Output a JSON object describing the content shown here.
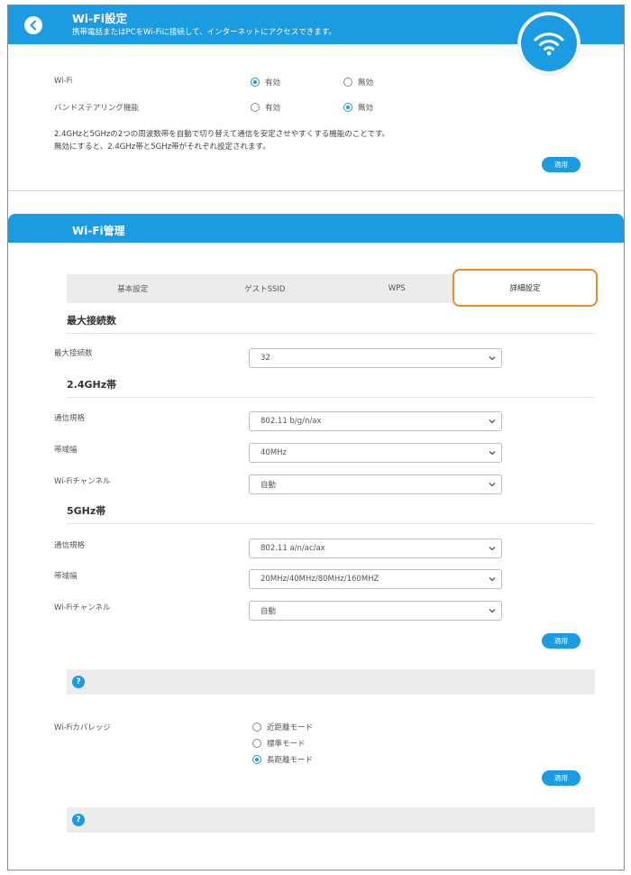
{
  "wifi_settings": {
    "title": "Wi-Fi設定",
    "subtitle": "携帯電話またはPCをWi-Fiに接続して、インターネットにアクセスできます。",
    "wifi_label": "Wi-Fi",
    "wifi_enabled": "有効",
    "wifi_disabled": "無効",
    "band_label": "バンドステアリング機能",
    "band_enabled": "有効",
    "band_disabled": "無効",
    "desc_line1": "2.4GHzと5GHzの2つの周波数帯を自動で切り替えて通信を安定させやすくする機能のことです。",
    "desc_line2": "無効にすると、2.4GHz帯と5GHz帯がそれぞれ設定されます。",
    "apply": "適用"
  },
  "wifi_management": {
    "title": "Wi-Fi管理",
    "tabs": [
      "基本設定",
      "ゲストSSID",
      "WPS",
      "詳細設定"
    ],
    "max_section_title": "最大接続数",
    "max_label": "最大接続数",
    "max_value": "32",
    "band24_title": "2.4GHz帯",
    "band24_standard_label": "通信規格",
    "band24_standard_value": "802.11 b/g/n/ax",
    "band24_width_label": "帯域幅",
    "band24_width_value": "40MHz",
    "band24_channel_label": "Wi-Fiチャンネル",
    "band24_channel_value": "自動",
    "band5_title": "5GHz帯",
    "band5_standard_label": "通信規格",
    "band5_standard_value": "802.11 a/n/ac/ax",
    "band5_width_label": "帯域幅",
    "band5_width_value": "20MHz/40MHz/80MHz/160MHZ",
    "band5_channel_label": "Wi-Fiチャンネル",
    "band5_channel_value": "自動",
    "apply": "適用",
    "help": "?",
    "coverage_label": "Wi-Fiカバレッジ",
    "coverage_options": [
      "近距離モード",
      "標準モード",
      "長距離モード"
    ],
    "apply2": "適用",
    "help2": "?"
  },
  "colors": {
    "accent": "#1a9be2",
    "highlight": "#f08a2c"
  }
}
